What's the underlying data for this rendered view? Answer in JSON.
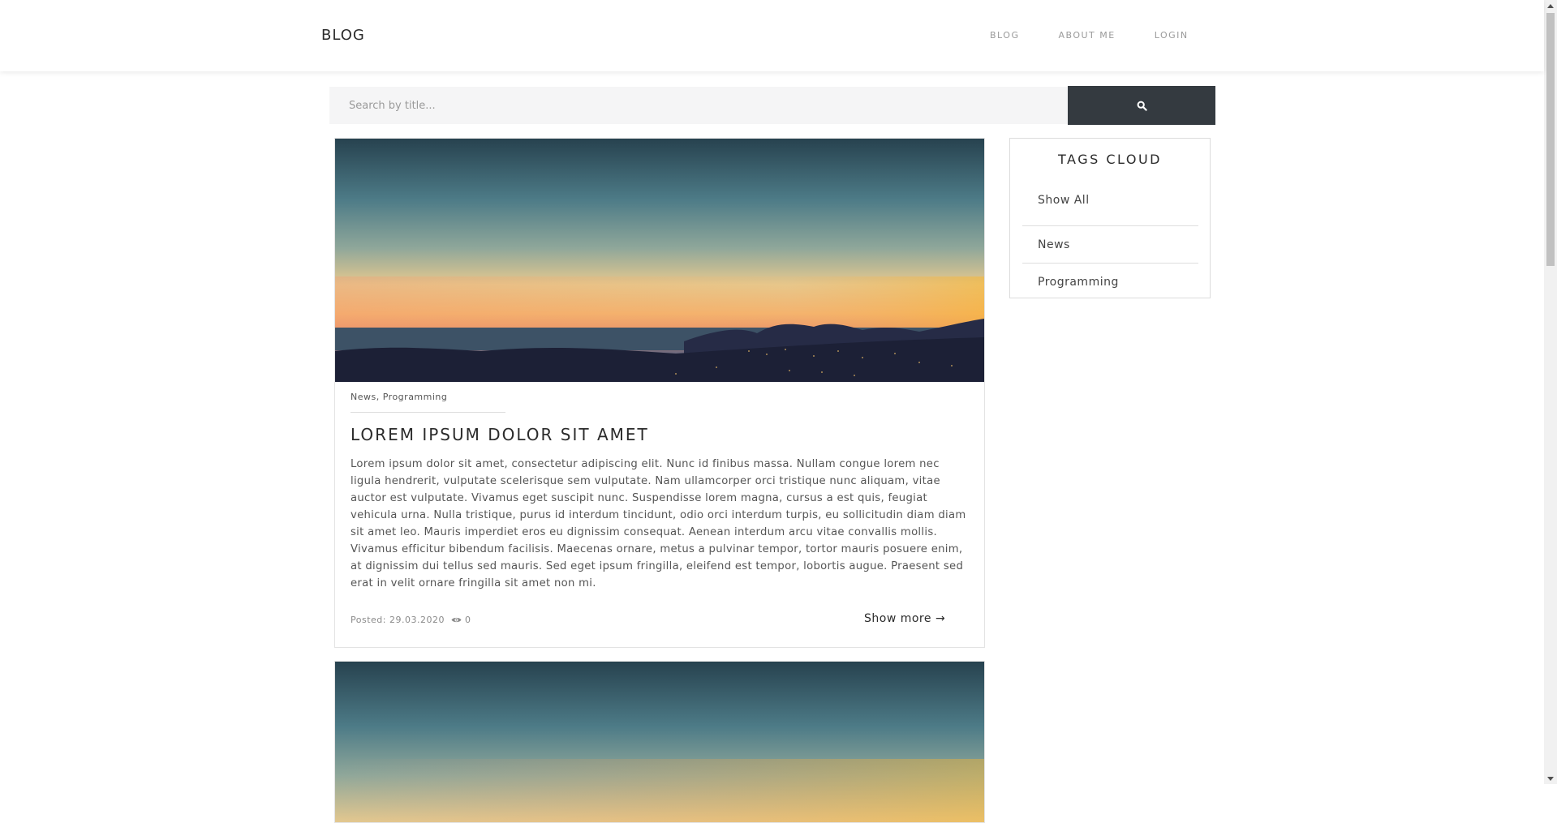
{
  "header": {
    "brand": "BLOG",
    "nav": [
      {
        "label": "BLOG"
      },
      {
        "label": "ABOUT ME"
      },
      {
        "label": "LOGIN"
      }
    ]
  },
  "search": {
    "placeholder": "Search by title...",
    "button_icon": "search-icon"
  },
  "posts": [
    {
      "image": "sunset-landscape",
      "tags": [
        "News",
        "Programming"
      ],
      "tag_separator": ", ",
      "title": "LOREM IPSUM DOLOR SIT AMET",
      "excerpt": "Lorem ipsum dolor sit amet, consectetur adipiscing elit. Nunc id finibus massa. Nullam congue lorem nec ligula hendrerit, vulputate scelerisque sem vulputate. Nam ullamcorper orci tristique nunc aliquam, vitae auctor est vulputate. Vivamus eget suscipit nunc. Suspendisse lorem magna, cursus a est quis, feugiat vehicula urna. Nulla tristique, purus id interdum tincidunt, odio orci interdum turpis, eu sollicitudin diam diam sit amet leo. Mauris imperdiet eros eu dignissim consequat. Aenean interdum arcu vitae convallis mollis. Vivamus efficitur bibendum facilisis. Maecenas ornare, metus a pulvinar tempor, tortor mauris posuere enim, at dignissim dui tellus sed mauris. Sed eget ipsum fringilla, eleifend est tempor, lobortis augue. Praesent sed erat in velit ornare fringilla sit amet non mi.",
      "posted": "Posted: 29.03.2020",
      "views": "0",
      "show_more": "Show more →"
    },
    {
      "image": "sunset-landscape"
    }
  ],
  "sidebar": {
    "title": "TAGS CLOUD",
    "tags": [
      {
        "label": "Show All"
      },
      {
        "label": "News"
      },
      {
        "label": "Programming"
      }
    ]
  },
  "colors": {
    "search_button": "#343a40",
    "search_bg": "#f5f5f6",
    "nav_text": "#9a9a9a"
  }
}
